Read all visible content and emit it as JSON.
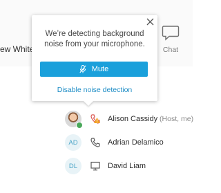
{
  "toolbar": {
    "left_label": "ew White",
    "chat_label": "Chat",
    "chat_icon": "chat-bubble-icon"
  },
  "popup": {
    "message": "We’re detecting background noise from your microphone.",
    "mute_label": "Mute",
    "mute_icon": "microphone-muted-icon",
    "disable_link": "Disable noise detection",
    "close_icon": "close-icon"
  },
  "participants": [
    {
      "name": "Alison Cassidy",
      "role": " (Host, me)",
      "avatar": "photo",
      "presence_color": "#4aa85a",
      "device_icon": "phone-icon",
      "alert_icon": "warning-icon"
    },
    {
      "name": "Adrian Delamico",
      "initials": "AD",
      "device_icon": "phone-icon"
    },
    {
      "name": "David Liam",
      "initials": "DL",
      "device_icon": "monitor-icon"
    }
  ],
  "colors": {
    "accent": "#1aa0db",
    "link": "#1c8cc5",
    "initials_text": "#4ea6c8",
    "warning": "#f0a020",
    "phone_red": "#d9534f"
  }
}
